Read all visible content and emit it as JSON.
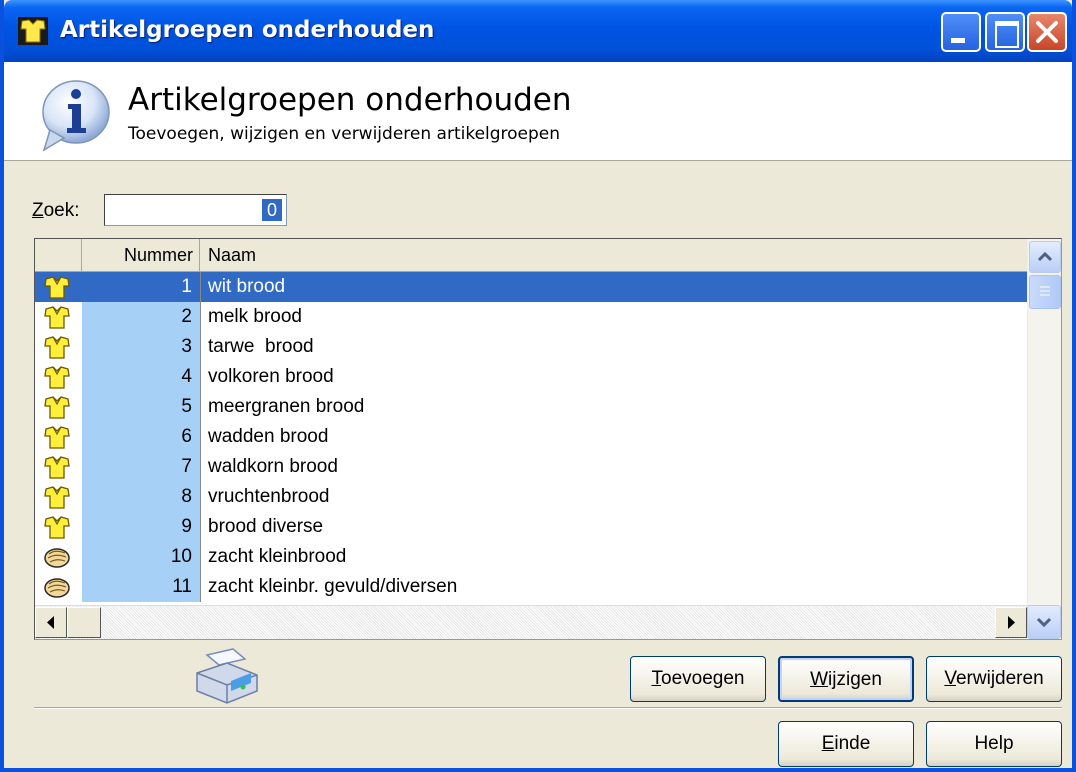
{
  "window": {
    "title": "Artikelgroepen onderhouden"
  },
  "header": {
    "title": "Artikelgroepen onderhouden",
    "subtitle": "Toevoegen, wijzigen en verwijderen artikelgroepen"
  },
  "search": {
    "label": "Zoek:",
    "value": "0"
  },
  "table": {
    "columns": [
      "",
      "Nummer",
      "Naam"
    ],
    "rows": [
      {
        "icon": "shirt-icon",
        "nummer": "1",
        "naam": "wit brood",
        "selected": true
      },
      {
        "icon": "shirt-icon",
        "nummer": "2",
        "naam": "melk brood"
      },
      {
        "icon": "shirt-icon",
        "nummer": "3",
        "naam": "tarwe  brood"
      },
      {
        "icon": "shirt-icon",
        "nummer": "4",
        "naam": "volkoren brood"
      },
      {
        "icon": "shirt-icon",
        "nummer": "5",
        "naam": "meergranen brood"
      },
      {
        "icon": "shirt-icon",
        "nummer": "6",
        "naam": "wadden brood"
      },
      {
        "icon": "shirt-icon",
        "nummer": "7",
        "naam": "waldkorn brood"
      },
      {
        "icon": "shirt-icon",
        "nummer": "8",
        "naam": "vruchtenbrood"
      },
      {
        "icon": "shirt-icon",
        "nummer": "9",
        "naam": "brood diverse"
      },
      {
        "icon": "bread-roll-icon",
        "nummer": "10",
        "naam": "zacht kleinbrood"
      },
      {
        "icon": "bread-roll-icon",
        "nummer": "11",
        "naam": "zacht kleinbr. gevuld/diversen"
      }
    ]
  },
  "buttons": {
    "toevoegen": "Toevoegen",
    "wijzigen": "Wijzigen",
    "verwijderen": "Verwijderen",
    "einde": "Einde",
    "help": "Help"
  },
  "colors": {
    "titlebar": "#0054e3",
    "selection": "#316ac5",
    "number_column": "#a6d0f5"
  }
}
